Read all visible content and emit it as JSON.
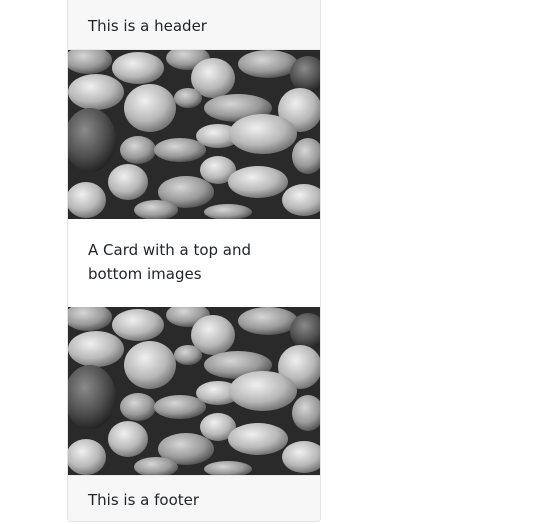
{
  "card": {
    "header": "This is a header",
    "body_text": "A Card with a top and bottom images",
    "footer": "This is a footer",
    "top_image": "pebbles-grayscale-photo",
    "bottom_image": "pebbles-grayscale-photo"
  },
  "colors": {
    "header_bg": "#f7f7f7",
    "border": "#e4e4e4",
    "text": "#212529"
  }
}
